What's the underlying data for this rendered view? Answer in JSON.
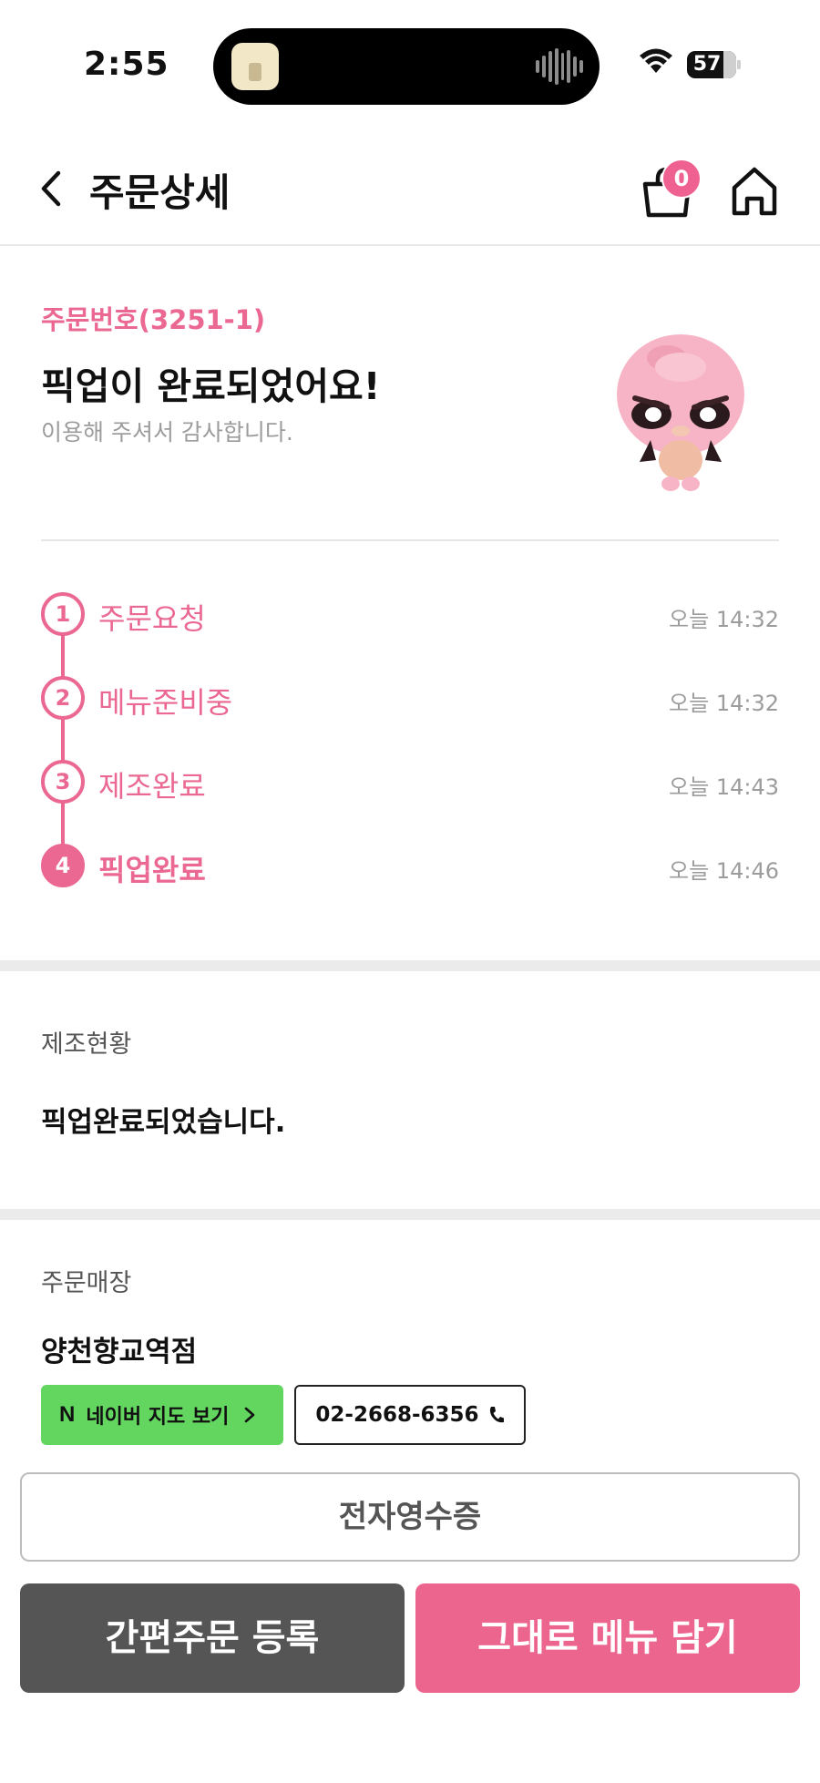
{
  "status_bar": {
    "time": "2:55",
    "battery": "57"
  },
  "nav": {
    "title": "주문상세",
    "cart_count": "0"
  },
  "order": {
    "number_label": "주문번호(3251-1)",
    "headline": "픽업이 완료되었어요!",
    "subtext": "이용해 주셔서 감사합니다."
  },
  "timeline": {
    "steps": [
      {
        "index": "1",
        "label": "주문요청",
        "time": "오늘 14:32"
      },
      {
        "index": "2",
        "label": "메뉴준비중",
        "time": "오늘 14:32"
      },
      {
        "index": "3",
        "label": "제조완료",
        "time": "오늘 14:43"
      },
      {
        "index": "4",
        "label": "픽업완료",
        "time": "오늘 14:46"
      }
    ],
    "current_step": 4
  },
  "status_section": {
    "label": "제조현황",
    "value": "픽업완료되었습니다."
  },
  "store_section": {
    "label": "주문매장",
    "store_name": "양천향교역점",
    "map_button": "네이버 지도 보기",
    "map_button_badge": "N",
    "phone": "02-2668-6356"
  },
  "actions": {
    "receipt": "전자영수증",
    "quick_order": "간편주문 등록",
    "add_menu": "그대로 메뉴 담기"
  },
  "colors": {
    "accent_pink": "#ea6892",
    "naver_green": "#62d65f",
    "dark_button": "#555555"
  },
  "icons": [
    "wifi-icon",
    "battery-icon",
    "back-chevron-icon",
    "shopping-bag-icon",
    "home-icon",
    "naver-logo-icon",
    "chevron-right-icon",
    "phone-icon"
  ]
}
